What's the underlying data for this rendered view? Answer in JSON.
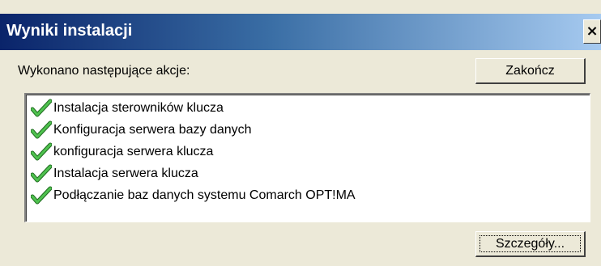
{
  "dialog": {
    "title": "Wyniki instalacji",
    "close_label": "×"
  },
  "main": {
    "actions_label": "Wykonano następujące akcje:",
    "finish_button": "Zakończ",
    "details_button": "Szczegóły..."
  },
  "actions": [
    {
      "label": "Instalacja sterowników klucza",
      "icon": "check-icon",
      "status": "done"
    },
    {
      "label": "Konfiguracja serwera bazy danych",
      "icon": "check-icon",
      "status": "done"
    },
    {
      "label": "konfiguracja serwera klucza",
      "icon": "check-icon",
      "status": "done"
    },
    {
      "label": "Instalacja serwera klucza",
      "icon": "check-icon",
      "status": "done"
    },
    {
      "label": "Podłączanie baz danych systemu Comarch OPT!MA",
      "icon": "check-icon",
      "status": "done"
    }
  ],
  "colors": {
    "title_gradient_start": "#0a246a",
    "title_gradient_end": "#a6caf0",
    "dialog_background": "#ece9d8",
    "check_green": "#2e9b2e"
  }
}
